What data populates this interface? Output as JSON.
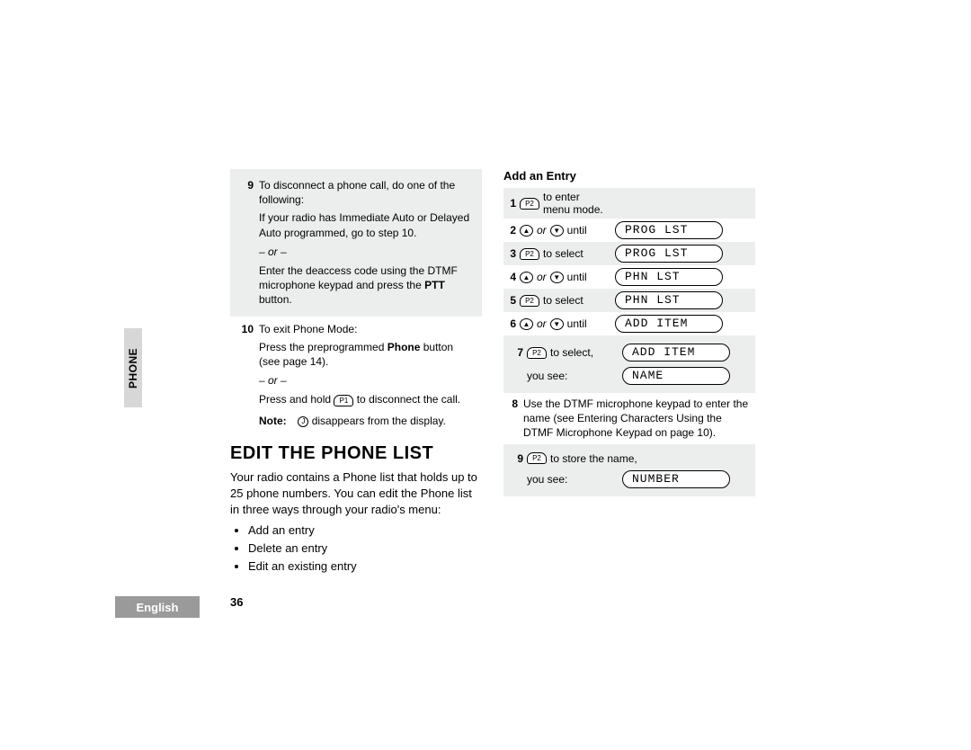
{
  "sidebar_label": "PHONE",
  "language": "English",
  "page_number": "36",
  "left": {
    "step9": {
      "num": "9",
      "line1": "To disconnect a phone call, do one of the following:",
      "line2": "If your radio has Immediate Auto or Delayed Auto programmed, go to step 10.",
      "or": "– or –",
      "line3a": "Enter the deaccess code using the DTMF microphone keypad and press the ",
      "line3_bold": "PTT",
      "line3b": " button."
    },
    "step10": {
      "num": "10",
      "line1": "To exit Phone Mode:",
      "line2a": "Press the preprogrammed ",
      "line2_bold": "Phone",
      "line2b": " button (see page 14).",
      "or": "– or –",
      "line3a": "Press and hold ",
      "line3_key": "P1",
      "line3b": " to disconnect the call."
    },
    "note": {
      "label": "Note:",
      "icon": "J",
      "text": " disappears from the display."
    },
    "heading": "EDIT THE PHONE LIST",
    "intro": "Your radio contains a Phone list that holds up to 25 phone numbers. You can edit the Phone list in three ways through your radio's menu:",
    "bullets": [
      "Add an entry",
      "Delete an entry",
      "Edit an existing entry"
    ]
  },
  "right": {
    "subheading": "Add an Entry",
    "rows": [
      {
        "num": "1",
        "key": "P2",
        "after": "to enter menu mode.",
        "lcd": null,
        "shade": true
      },
      {
        "num": "2",
        "updown": true,
        "after": "until",
        "lcd": "PROG LST",
        "shade": false
      },
      {
        "num": "3",
        "key": "P2",
        "after": "to select",
        "lcd": "PROG LST",
        "shade": true
      },
      {
        "num": "4",
        "updown": true,
        "after": "until",
        "lcd": "PHN LST",
        "shade": false
      },
      {
        "num": "5",
        "key": "P2",
        "after": "to select",
        "lcd": "PHN LST",
        "shade": true
      },
      {
        "num": "6",
        "updown": true,
        "after": "until",
        "lcd": "ADD ITEM",
        "shade": false
      },
      {
        "num": "7",
        "key": "P2",
        "after": "to select,",
        "lcd": "ADD ITEM",
        "shade": true
      },
      {
        "num": "",
        "you_see": "you see:",
        "lcd": "NAME",
        "shade": true
      }
    ],
    "step8": {
      "num": "8",
      "text": "Use the DTMF microphone keypad to enter the name (see Entering Characters Using the DTMF Microphone Keypad on page 10)."
    },
    "step9": {
      "num": "9",
      "key": "P2",
      "after": "to store the name,",
      "you_see": "you see:",
      "lcd": "NUMBER"
    }
  }
}
